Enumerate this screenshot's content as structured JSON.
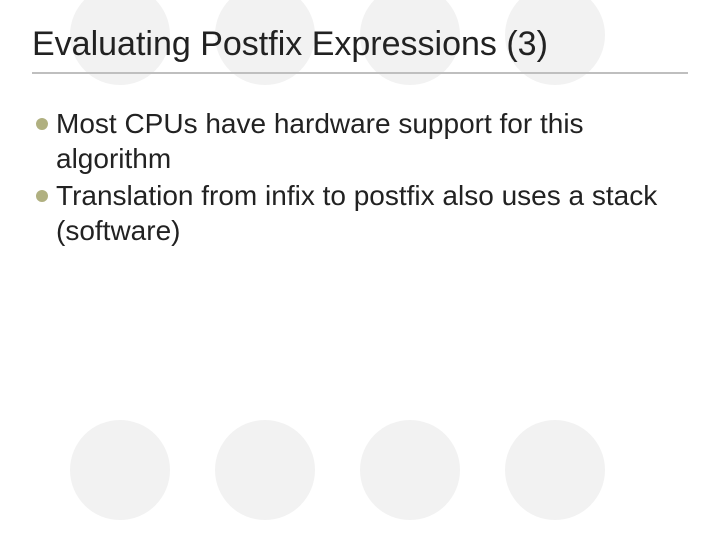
{
  "slide": {
    "title": "Evaluating Postfix Expressions (3)",
    "bullets": [
      "Most CPUs have hardware support for this algorithm",
      "Translation from infix to postfix also uses a stack (software)"
    ]
  }
}
